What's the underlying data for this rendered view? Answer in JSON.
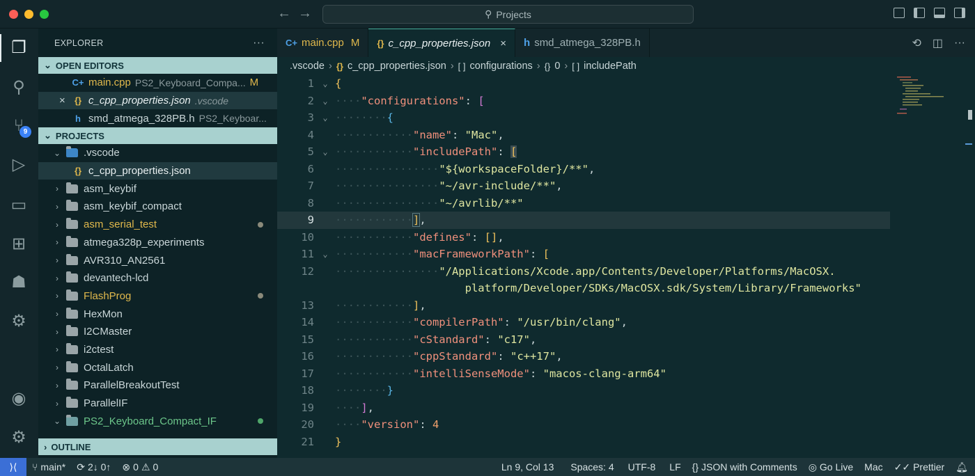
{
  "window": {
    "search_text": "Projects"
  },
  "activity_bar": {
    "items": [
      "explorer-icon",
      "search-icon",
      "source-control-icon",
      "run-debug-icon",
      "remote-explorer-icon",
      "extensions-icon",
      "docker-icon",
      "cmake-icon",
      "account-icon",
      "settings-icon"
    ],
    "scm_badge": "9"
  },
  "sidebar": {
    "title": "EXPLORER",
    "more": "···",
    "open_editors_label": "OPEN EDITORS",
    "open_editors": [
      {
        "name": "main.cpp",
        "desc": "PS2_Keyboard_Compa...",
        "status": "M"
      },
      {
        "name": "c_cpp_properties.json",
        "desc": ".vscode",
        "close": "×"
      },
      {
        "name": "smd_atmega_328PB.h",
        "desc": "PS2_Keyboar..."
      }
    ],
    "projects_label": "PROJECTS",
    "vscode_folder": ".vscode",
    "vscode_file": "c_cpp_properties.json",
    "folders": [
      {
        "name": "asm_keybif"
      },
      {
        "name": "asm_keybif_compact"
      },
      {
        "name": "asm_serial_test",
        "modified": true
      },
      {
        "name": "atmega328p_experiments"
      },
      {
        "name": "AVR310_AN2561"
      },
      {
        "name": "devantech-lcd"
      },
      {
        "name": "FlashProg",
        "modified": true
      },
      {
        "name": "HexMon"
      },
      {
        "name": "I2CMaster"
      },
      {
        "name": "i2ctest"
      },
      {
        "name": "OctalLatch"
      },
      {
        "name": "ParallelBreakoutTest"
      },
      {
        "name": "ParallelIF"
      }
    ],
    "open_project": "PS2_Keyboard_Compact_IF",
    "outline_label": "OUTLINE"
  },
  "tabs": [
    {
      "label": "main.cpp",
      "status": "M"
    },
    {
      "label": "c_cpp_properties.json",
      "close": "×"
    },
    {
      "label": "smd_atmega_328PB.h"
    }
  ],
  "breadcrumb": [
    ".vscode",
    "c_cpp_properties.json",
    "configurations",
    "0",
    "includePath"
  ],
  "editor": {
    "line_numbers": [
      "1",
      "2",
      "3",
      "4",
      "5",
      "6",
      "7",
      "8",
      "9",
      "10",
      "11",
      "12",
      "",
      "13",
      "14",
      "15",
      "16",
      "17",
      "18",
      "19",
      "20",
      "21"
    ],
    "code": {
      "name_key": "\"name\"",
      "name_val": "\"Mac\"",
      "configs_key": "\"configurations\"",
      "include_key": "\"includePath\"",
      "inc1": "\"${workspaceFolder}/**\"",
      "inc2": "\"~/avr-include/**\"",
      "inc3": "\"~/avrlib/**\"",
      "defines_key": "\"defines\"",
      "mac_key": "\"macFrameworkPath\"",
      "mac_val_a": "\"/Applications/Xcode.app/Contents/Developer/Platforms/MacOSX.",
      "mac_val_b": "platform/Developer/SDKs/MacOSX.sdk/System/Library/Frameworks\"",
      "compiler_key": "\"compilerPath\"",
      "compiler_val": "\"/usr/bin/clang\"",
      "cstd_key": "\"cStandard\"",
      "cstd_val": "\"c17\"",
      "cppstd_key": "\"cppStandard\"",
      "cppstd_val": "\"c++17\"",
      "intelli_key": "\"intelliSenseMode\"",
      "intelli_val": "\"macos-clang-arm64\"",
      "version_key": "\"version\"",
      "version_val": "4"
    }
  },
  "status_bar": {
    "branch": "main*",
    "sync": "2↓ 0↑",
    "errors": "0",
    "warnings": "0",
    "position": "Ln 9, Col 13",
    "spaces": "Spaces: 4",
    "encoding": "UTF-8",
    "eol": "LF",
    "language": "JSON with Comments",
    "live": "Go Live",
    "platform": "Mac",
    "formatter": "Prettier"
  },
  "colors": {
    "accent": "#3b6fd6",
    "section_header": "#a8d1cf",
    "modified": "#e0b84c"
  }
}
